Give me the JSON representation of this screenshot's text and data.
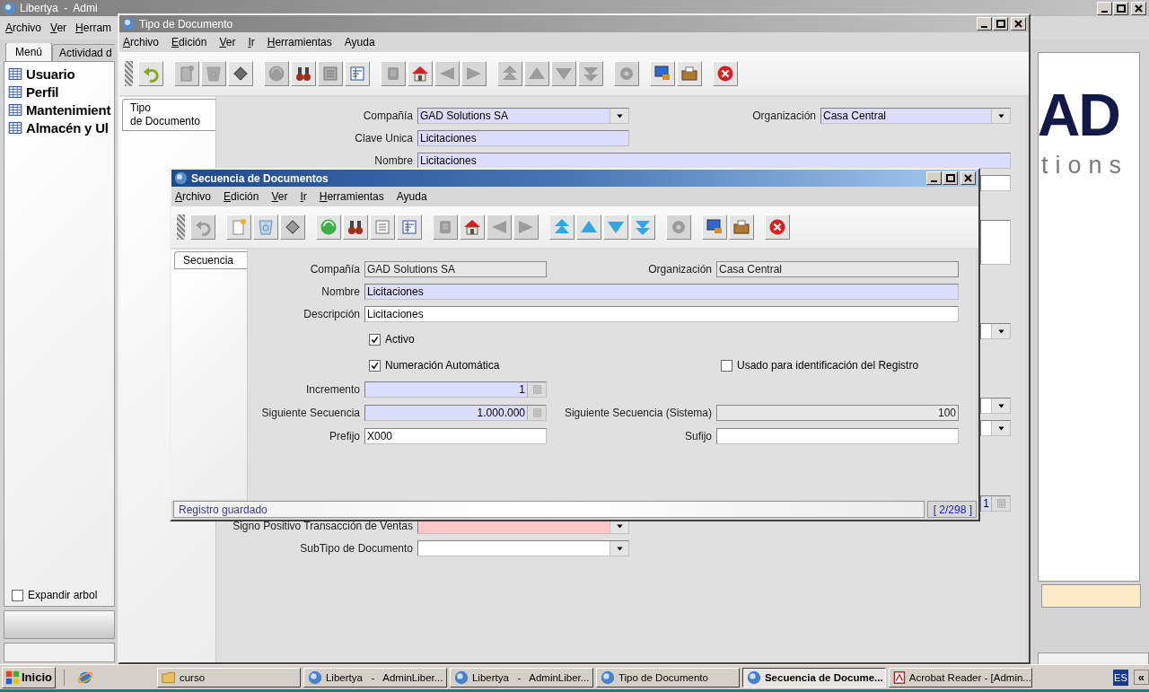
{
  "main_window": {
    "title": "Libertya  -  Admi",
    "active": false,
    "menu": [
      {
        "label": "Archivo",
        "mnemonic": true
      },
      {
        "label": "Ver",
        "mnemonic": true
      },
      {
        "label": "Herram",
        "mnemonic": true
      }
    ],
    "tabs": [
      {
        "label": "Menú",
        "selected": true
      },
      {
        "label": "Actividad d",
        "selected": false
      }
    ],
    "tree": [
      {
        "label": "Usuario"
      },
      {
        "label": "Perfil"
      },
      {
        "label": "Mantenimient"
      },
      {
        "label": "Almacén y Ul"
      }
    ],
    "expand_tree": {
      "label": "Expandir arbol",
      "checked": false
    },
    "logo": {
      "text_top": "AD",
      "text_bottom": "tions"
    }
  },
  "document_type_window": {
    "title": "Tipo de Documento",
    "active": false,
    "menu": [
      {
        "label": "Archivo",
        "mnemonic": true
      },
      {
        "label": "Edición",
        "mnemonic": true
      },
      {
        "label": "Ver",
        "mnemonic": true
      },
      {
        "label": "Ir",
        "mnemonic": true
      },
      {
        "label": "Herramientas",
        "mnemonic": true
      },
      {
        "label": "Ayuda",
        "mnemonic": false
      }
    ],
    "toolbar": [
      {
        "disabled": false
      },
      {
        "disabled": true
      },
      {
        "disabled": true
      },
      {
        "disabled": false
      },
      {
        "disabled": true
      },
      {
        "disabled": false
      },
      {
        "disabled": true
      },
      {
        "disabled": false
      },
      {
        "disabled": true
      },
      {
        "disabled": false
      },
      {
        "disabled": true
      },
      {
        "disabled": true
      },
      {
        "disabled": true
      },
      {
        "disabled": true
      },
      {
        "disabled": true
      },
      {
        "disabled": true
      },
      {
        "disabled": true
      },
      {
        "disabled": false
      },
      {
        "disabled": false
      },
      {
        "disabled": false
      }
    ],
    "tabs": [
      {
        "label": "Tipo\nde Documento",
        "selected": true
      }
    ],
    "rows": [
      {
        "fields": [
          {
            "label": "Compañía",
            "value": "GAD Solutions SA",
            "kind": "dropdown",
            "mandatory": true,
            "read_only": false
          },
          {
            "label": "Organización",
            "value": "Casa Central",
            "kind": "dropdown",
            "mandatory": true,
            "read_only": false
          }
        ]
      },
      {
        "fields": [
          {
            "label": "Clave Unica",
            "value": "Licitaciones",
            "kind": "text",
            "mandatory": true,
            "read_only": false
          }
        ]
      },
      {
        "fields": [
          {
            "label": "Nombre",
            "value": "Licitaciones",
            "kind": "text",
            "mandatory": true,
            "read_only": false
          }
        ]
      },
      {
        "fields": [
          {
            "kind": "text",
            "mandatory": false,
            "read_only": false
          }
        ]
      },
      {
        "fields": [
          {
            "kind": "textarea",
            "mandatory": false,
            "read_only": false
          }
        ]
      },
      {
        "fields": [
          {
            "kind": "dropdown",
            "mandatory": false,
            "read_only": false
          }
        ]
      },
      {
        "fields": [
          {
            "kind": "dropdown",
            "mandatory": false,
            "read_only": false
          }
        ]
      },
      {
        "fields": [
          {
            "kind": "dropdown",
            "mandatory": false,
            "read_only": false
          }
        ]
      },
      {
        "fields": [
          {
            "value": "1",
            "kind": "number",
            "mandatory": true,
            "read_only": false,
            "calculator": true
          }
        ]
      },
      {
        "fields": [
          {
            "label": "Signo Positivo Transacción de Ventas",
            "kind": "dropdown",
            "read_only": false,
            "invalid": true
          }
        ]
      },
      {
        "fields": [
          {
            "label": "SubTipo de Documento",
            "kind": "dropdown",
            "mandatory": false,
            "read_only": false
          }
        ]
      }
    ]
  },
  "sequence_window": {
    "title": "Secuencia de Documentos",
    "active": true,
    "menu": [
      {
        "label": "Archivo",
        "mnemonic": true
      },
      {
        "label": "Edición",
        "mnemonic": true
      },
      {
        "label": "Ver",
        "mnemonic": true
      },
      {
        "label": "Ir",
        "mnemonic": true
      },
      {
        "label": "Herramientas",
        "mnemonic": true
      },
      {
        "label": "Ayuda",
        "mnemonic": false
      }
    ],
    "toolbar": [
      {
        "disabled": true
      },
      {
        "disabled": false
      },
      {
        "disabled": false
      },
      {
        "disabled": true
      },
      {
        "disabled": false
      },
      {
        "disabled": false
      },
      {
        "disabled": false
      },
      {
        "disabled": false
      },
      {
        "disabled": true
      },
      {
        "disabled": false
      },
      {
        "disabled": true
      },
      {
        "disabled": true
      },
      {
        "disabled": false
      },
      {
        "disabled": false
      },
      {
        "disabled": false
      },
      {
        "disabled": false
      },
      {
        "disabled": true
      },
      {
        "disabled": false
      },
      {
        "disabled": false
      },
      {
        "disabled": false
      }
    ],
    "tabs": [
      {
        "label": "Secuencia",
        "selected": true
      }
    ],
    "rows": [
      {
        "fields": [
          {
            "label": "Compañía",
            "value": "GAD Solutions SA",
            "kind": "text",
            "mandatory": false,
            "read_only": true
          },
          {
            "label": "Organización",
            "value": "Casa Central",
            "kind": "text",
            "mandatory": false,
            "read_only": true
          }
        ]
      },
      {
        "fields": [
          {
            "label": "Nombre",
            "value": "Licitaciones",
            "kind": "text",
            "mandatory": true,
            "read_only": false
          }
        ]
      },
      {
        "fields": [
          {
            "label": "Descripción",
            "value": "Licitaciones",
            "kind": "text",
            "mandatory": false,
            "read_only": false
          }
        ]
      },
      {
        "fields": [
          {
            "label": "Activo",
            "kind": "checkbox",
            "checked": true
          }
        ]
      },
      {
        "fields": [
          {
            "label": "Numeración Automática",
            "kind": "checkbox",
            "checked": true
          },
          {
            "label": "Usado para identificación del Registro",
            "kind": "checkbox",
            "checked": false
          }
        ]
      },
      {
        "fields": [
          {
            "label": "Incremento",
            "value": "1",
            "kind": "number",
            "mandatory": true,
            "read_only": false,
            "calculator": true
          }
        ]
      },
      {
        "fields": [
          {
            "label": "Siguiente Secuencia",
            "value": "1.000.000",
            "kind": "number",
            "mandatory": true,
            "read_only": false,
            "calculator": true
          },
          {
            "label": "Siguiente Secuencia (Sistema)",
            "value": "100",
            "kind": "number",
            "mandatory": false,
            "read_only": true,
            "calculator": false
          }
        ]
      },
      {
        "fields": [
          {
            "label": "Prefijo",
            "value": "X000",
            "kind": "text",
            "mandatory": false,
            "read_only": false
          },
          {
            "label": "Sufijo",
            "kind": "text",
            "mandatory": false,
            "read_only": false
          }
        ]
      }
    ],
    "status_bar": {
      "message": "Registro guardado",
      "record": "[ 2/298 ]"
    }
  },
  "taskbar": {
    "start": "Inicio",
    "items": [
      {
        "label": "curso",
        "kind": "folder",
        "selected": false
      },
      {
        "label": "Libertya   -   AdminLiber...",
        "kind": "app",
        "selected": false
      },
      {
        "label": "Libertya   -   AdminLiber...",
        "kind": "app",
        "selected": false
      },
      {
        "label": "Tipo de Documento",
        "kind": "app",
        "selected": false
      },
      {
        "label": "Secuencia de Docume...",
        "kind": "app",
        "selected": true
      },
      {
        "label": "Acrobat Reader - [Admin...",
        "kind": "acrobat",
        "selected": false
      }
    ],
    "language": "ES",
    "expand": "«"
  }
}
